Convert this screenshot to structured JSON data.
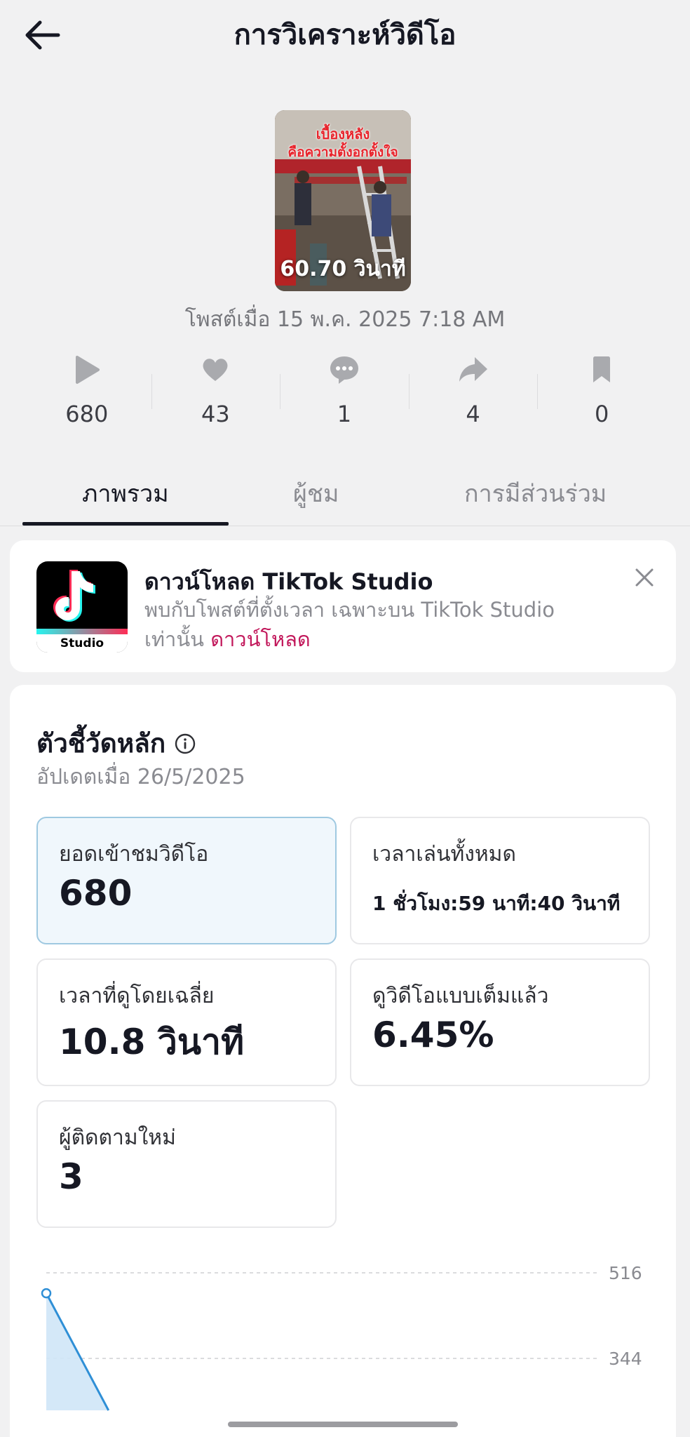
{
  "header": {
    "title": "การวิเคราะห์วิดีโอ"
  },
  "video": {
    "overlay_line1": "เบื้องหลัง",
    "overlay_line2": "คือความตั้งอกตั้งใจ",
    "duration": "60.70 วินาที",
    "posted": "โพสต์เมื่อ 15 พ.ค. 2025 7:18 AM"
  },
  "stats": [
    {
      "icon": "play-icon",
      "value": "680"
    },
    {
      "icon": "heart-icon",
      "value": "43"
    },
    {
      "icon": "comment-icon",
      "value": "1"
    },
    {
      "icon": "share-icon",
      "value": "4"
    },
    {
      "icon": "bookmark-icon",
      "value": "0"
    }
  ],
  "tabs": [
    {
      "label": "ภาพรวม",
      "active": true
    },
    {
      "label": "ผู้ชม",
      "active": false
    },
    {
      "label": "การมีส่วนร่วม",
      "active": false
    }
  ],
  "promo": {
    "icon_label": "Studio",
    "title": "ดาวน์โหลด TikTok Studio",
    "desc": "พบกับโพสต์ที่ตั้งเวลา เฉพาะบน TikTok Studio เท่านั้น",
    "link": "ดาวน์โหลด"
  },
  "metrics": {
    "title": "ตัวชี้วัดหลัก",
    "updated": "อัปเดตเมื่อ 26/5/2025",
    "tiles": [
      {
        "label": "ยอดเข้าชมวิดีโอ",
        "value": "680"
      },
      {
        "label": "เวลาเล่นทั้งหมด",
        "value": "1 ชั่วโมง:59 นาที:40 วินาที"
      },
      {
        "label": "เวลาที่ดูโดยเฉลี่ย",
        "value": "10.8 วินาที"
      },
      {
        "label": "ดูวิดีโอแบบเต็มแล้ว",
        "value": "6.45%"
      },
      {
        "label": "ผู้ติดตามใหม่",
        "value": "3"
      }
    ]
  },
  "chart_data": {
    "type": "area",
    "y_ticks": [
      516,
      344
    ],
    "y_tick_labels": [
      "516",
      "344"
    ],
    "series": [
      {
        "values": [
          {
            "x": 0,
            "y": 475
          },
          {
            "x": 1,
            "y": 300
          }
        ]
      }
    ],
    "grid": "dashed",
    "color": "#2f8fd6"
  },
  "colors": {
    "accent_link": "#c2185b",
    "selected_tile_bg": "#f0f7fc",
    "chart_line": "#2f8fd6"
  }
}
